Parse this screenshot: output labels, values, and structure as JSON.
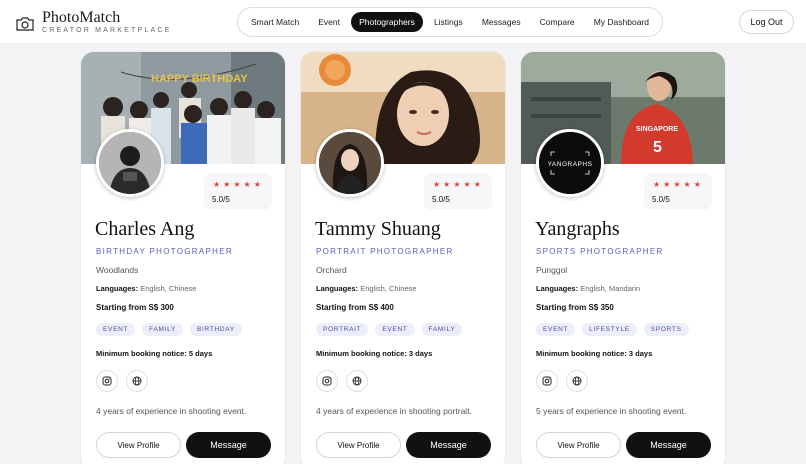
{
  "brand": {
    "name": "PhotoMatch",
    "tagline": "CREATOR MARKETPLACE"
  },
  "nav": {
    "items": [
      "Smart Match",
      "Event",
      "Photographers",
      "Listings",
      "Messages",
      "Compare",
      "My Dashboard"
    ],
    "active": "Photographers"
  },
  "logout_label": "Log Out",
  "labels": {
    "languages": "Languages:",
    "starting": "Starting from",
    "notice": "Minimum booking notice:",
    "view": "View Profile",
    "message": "Message"
  },
  "photographers": [
    {
      "name": "Charles Ang",
      "role": "BIRTHDAY PHOTOGRAPHER",
      "location": "Woodlands",
      "languages": "English, Chinese",
      "price": "S$ 300",
      "tags": [
        "EVENT",
        "FAMILY",
        "BIRTHDAY"
      ],
      "notice": "5 days",
      "experience": "4 years of experience in shooting event.",
      "stars": "★★★★★",
      "rating": "5.0/5",
      "cover_banner": "HAPPY BIRTHDAY"
    },
    {
      "name": "Tammy Shuang",
      "role": "PORTRAIT PHOTOGRAPHER",
      "location": "Orchard",
      "languages": "English, Chinese",
      "price": "S$ 400",
      "tags": [
        "PORTRAIT",
        "EVENT",
        "FAMILY"
      ],
      "notice": "3 days",
      "experience": "4 years of experience in shooting portrait.",
      "stars": "★★★★★",
      "rating": "5.0/5"
    },
    {
      "name": "Yangraphs",
      "role": "SPORTS PHOTOGRAPHER",
      "location": "Punggol",
      "languages": "English, Mandarin",
      "price": "S$ 350",
      "tags": [
        "EVENT",
        "LIFESTYLE",
        "SPORTS"
      ],
      "notice": "3 days",
      "experience": "5 years of experience in shooting event.",
      "stars": "★★★★★",
      "rating": "5.0/5",
      "avatar_logo": "YANGRAPHS",
      "jersey_text": "SINGAPORE",
      "jersey_number": "5"
    }
  ],
  "colors": {
    "accent": "#5a5fb8",
    "star": "#d9463e",
    "primary_button": "#111111"
  },
  "icons": [
    "instagram-icon",
    "globe-icon"
  ]
}
